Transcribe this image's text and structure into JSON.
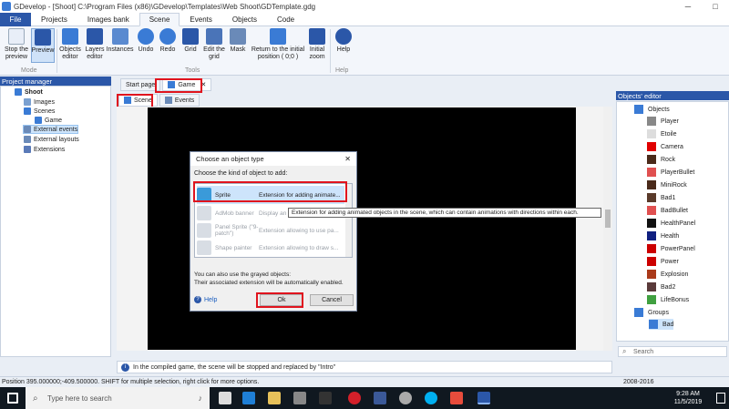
{
  "window": {
    "title": "GDevelop - [Shoot] C:\\Program Files (x86)\\GDevelop\\Templates\\Web Shoot\\GDTemplate.gdg"
  },
  "ribbon_tabs": [
    "File",
    "Projects",
    "Images bank",
    "Scene",
    "Events",
    "Objects",
    "Code"
  ],
  "ribbon": {
    "stop_preview": "Stop the preview",
    "preview": "Preview",
    "mode_group": "Mode",
    "objects_editor": "Objects editor",
    "layers_editor": "Layers editor",
    "instances": "Instances",
    "undo": "Undo",
    "redo": "Redo",
    "grid": "Grid",
    "edit_grid": "Edit the grid",
    "mask": "Mask",
    "return_initial": "Return to the initial position ( 0;0 )",
    "initial_zoom": "Initial zoom",
    "tools_group": "Tools",
    "help": "Help",
    "help_group": "Help"
  },
  "project_manager": {
    "title": "Project manager",
    "items": [
      "Shoot",
      "Images",
      "Scenes",
      "Game",
      "External events",
      "External layouts",
      "Extensions"
    ]
  },
  "editor_tabs": [
    "Start page",
    "Game"
  ],
  "scene_tabs": [
    "Scene",
    "Events"
  ],
  "dialog": {
    "title": "Choose an object type",
    "prompt": "Choose the kind of object to add:",
    "rows": [
      {
        "name": "Sprite",
        "desc": "Extension for adding animate..."
      },
      {
        "name": "AdMob banner",
        "desc": "Display an ad..."
      },
      {
        "name": "Panel Sprite (\"9-patch\")",
        "desc": "Extension allowing to use pa..."
      },
      {
        "name": "Shape painter",
        "desc": "Extension allowing to draw s..."
      }
    ],
    "note1": "You can also use the grayed objects:",
    "note2": "Their associated extension will be automatically enabled.",
    "help": "Help",
    "ok": "Ok",
    "cancel": "Cancel"
  },
  "tooltip": "Extension for adding animated objects in the scene, which can contain animations with directions within each.",
  "info_bar": "In the compiled game, the scene will be stopped and replaced by \"Intro\"",
  "objects_editor": {
    "title": "Objects' editor",
    "root": "Objects",
    "objects": [
      {
        "name": "Player",
        "color": "#888888"
      },
      {
        "name": "Etoile",
        "color": "#dddddd"
      },
      {
        "name": "Camera",
        "color": "#e00000"
      },
      {
        "name": "Rock",
        "color": "#4a2a1a"
      },
      {
        "name": "PlayerBullet",
        "color": "#e05050"
      },
      {
        "name": "MiniRock",
        "color": "#4a2a1a"
      },
      {
        "name": "Bad1",
        "color": "#5a3a2a"
      },
      {
        "name": "BadBullet",
        "color": "#e05050"
      },
      {
        "name": "HealthPanel",
        "color": "#111111"
      },
      {
        "name": "Health",
        "color": "#102080"
      },
      {
        "name": "PowerPanel",
        "color": "#cc0000"
      },
      {
        "name": "Power",
        "color": "#cc0000"
      },
      {
        "name": "Explosion",
        "color": "#aa3a1a"
      },
      {
        "name": "Bad2",
        "color": "#5a3a3a"
      },
      {
        "name": "LifeBonus",
        "color": "#40a040"
      }
    ],
    "groups_label": "Groups",
    "group_item": "Bad",
    "search_placeholder": "Search"
  },
  "status": {
    "position": "Position 395.000000;-409.500000. SHIFT for multiple selection, right click for more options.",
    "years": "2008-2016"
  },
  "taskbar": {
    "search_placeholder": "Type here to search",
    "time": "9:28 AM",
    "date": "11/5/2019"
  }
}
